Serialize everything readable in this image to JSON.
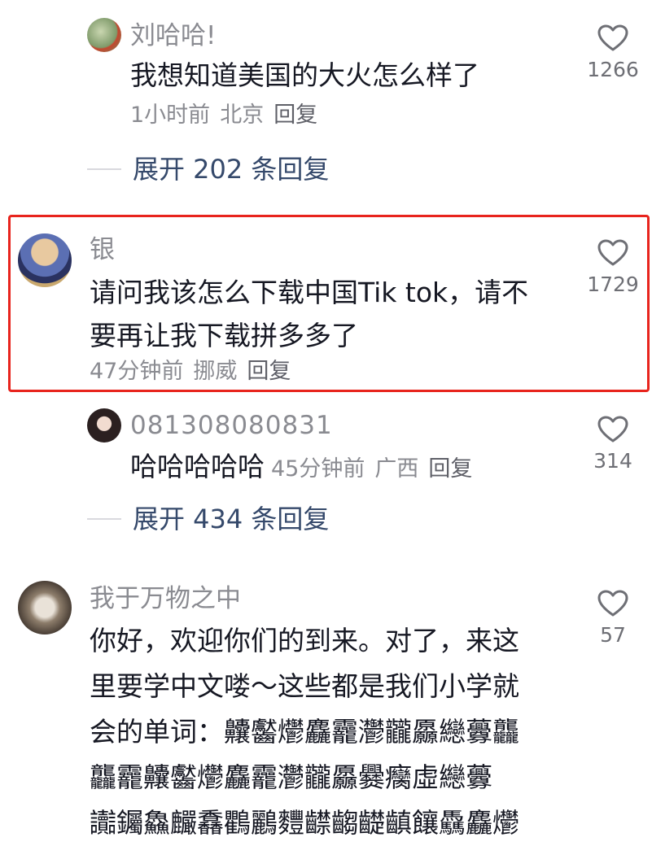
{
  "comments": [
    {
      "username": "刘哈哈!",
      "text": "我想知道美国的大火怎么样了",
      "time": "1小时前",
      "location": "北京",
      "reply_label": "回复",
      "likes": "1266"
    },
    {
      "username": "银",
      "text_line1": "请问我该怎么下载中国Tik tok，请不",
      "text_line2": "要再让我下载拼多多了",
      "time": "47分钟前",
      "location": "挪威",
      "reply_label": "回复",
      "likes": "1729"
    },
    {
      "username": "081308080831",
      "text": "哈哈哈哈哈",
      "time": "45分钟前",
      "location": "广西",
      "reply_label": "回复",
      "likes": "314"
    },
    {
      "username": "我于万物之中",
      "lines": [
        "你好，欢迎你们的到来。对了，来这",
        "里要学中文喽～这些都是我们小学就",
        "会的单词：齉齾爩麤龗灪龖厵纞虋龘",
        "龘龗齉齾爩麤龗灪龖厵爨癵虛纞虋",
        "讟钃鱻麣馫鸜鸝麷齽齺齼齻饟驫麤爩"
      ],
      "likes": "57"
    }
  ],
  "expand_replies": [
    {
      "label": "展开 202 条回复"
    },
    {
      "label": "展开 434 条回复"
    }
  ],
  "colors": {
    "highlight_border": "#e8241d",
    "expand_text": "#35496b",
    "secondary_text": "#8a8b91"
  },
  "icons": {
    "like": "heart-outline-icon"
  }
}
